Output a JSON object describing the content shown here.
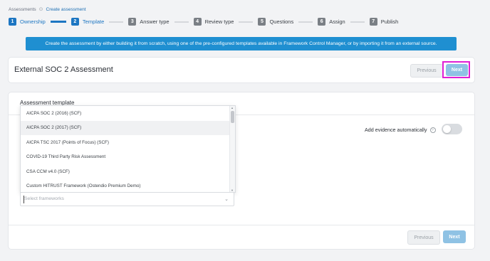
{
  "breadcrumb": {
    "root": "Assessments",
    "current": "Create assessment"
  },
  "steps": [
    {
      "n": "1",
      "label": "Ownership"
    },
    {
      "n": "2",
      "label": "Template"
    },
    {
      "n": "3",
      "label": "Answer type"
    },
    {
      "n": "4",
      "label": "Review type"
    },
    {
      "n": "5",
      "label": "Questions"
    },
    {
      "n": "6",
      "label": "Assign"
    },
    {
      "n": "7",
      "label": "Publish"
    }
  ],
  "banner": "Create the assessment by either building it from scratch, using one of the pre-configured templates available in Framework Control Manager, or by importing it from an external source.",
  "header": {
    "title": "External SOC 2 Assessment",
    "previous": "Previous",
    "next": "Next"
  },
  "section": {
    "heading": "Assessment template"
  },
  "evidence": {
    "label": "Add evidence automatically",
    "enabled": false
  },
  "frameworks": {
    "options": [
      "AICPA SOC 2 (2016) (SCF)",
      "AICPA SOC 2 (2017) (SCF)",
      "AICPA TSC 2017 (Points of Focus) (SCF)",
      "COVID-19 Third Party Risk Assessment",
      "CSA CCM v4.0 (SCF)",
      "Custom HITRUST Framework (Ostendio Premium Demo)"
    ],
    "selected_index": 1,
    "placeholder": "Select frameworks"
  },
  "footer": {
    "previous": "Previous",
    "next": "Next"
  },
  "colors": {
    "accent": "#1d76c2",
    "banner": "#1f8fd1",
    "next_button": "#8fc2e4",
    "highlight": "#e01fd4"
  }
}
